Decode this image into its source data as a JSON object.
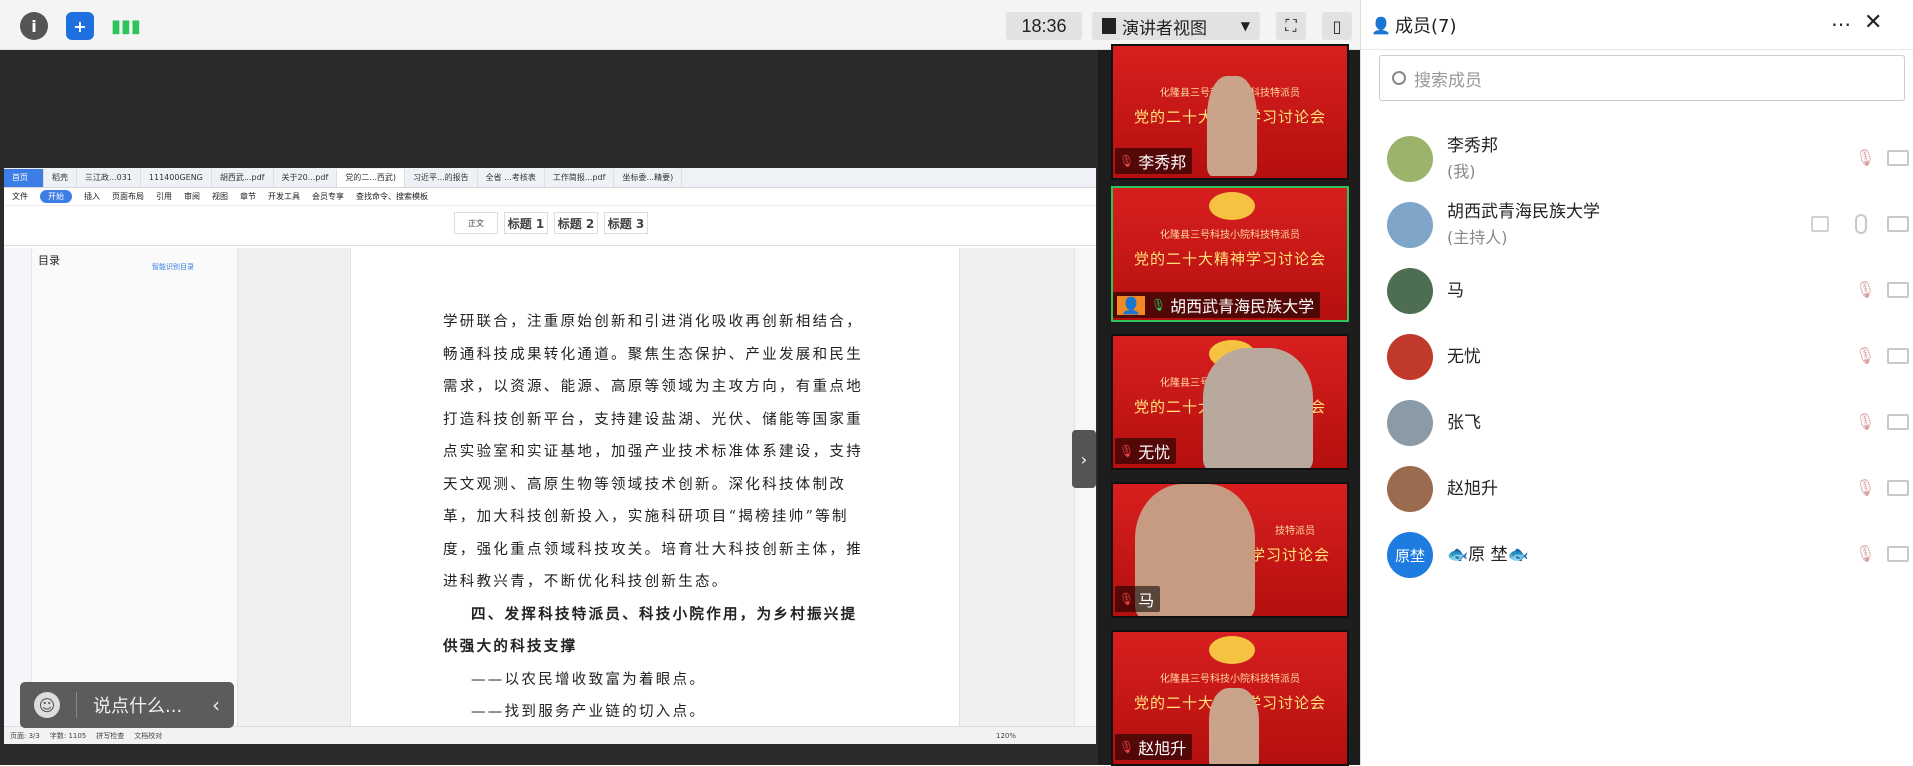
{
  "topbar": {
    "time": "18:36",
    "view_label": "演讲者视图",
    "icons": [
      "info-icon",
      "shield-icon",
      "signal-icon",
      "fullscreen-icon",
      "sidebar-toggle-icon"
    ]
  },
  "wps": {
    "tabs": [
      "首页",
      "稻壳",
      "三江政...031",
      "111400GENG",
      "胡西武...pdf",
      "关于20...pdf",
      "党的二...西武)",
      "习近平...的报告",
      "全省 ...考核表",
      "工作简报...pdf",
      "坐标委...精要)"
    ],
    "menus": [
      "文件",
      "开始",
      "插入",
      "页面布局",
      "引用",
      "审阅",
      "视图",
      "章节",
      "开发工具",
      "会员专享",
      "查找命令、搜索模板"
    ],
    "styles": [
      "正文",
      "标题 1",
      "标题 2",
      "标题 3"
    ],
    "toc_title": "目录",
    "toc_tool": "智能识别目录",
    "paragraphs": [
      "学研联合，注重原始创新和引进消化吸收再创新相结合，畅通科技成果转化通道。聚焦生态保护、产业发展和民生需求，以资源、能源、高原等领域为主攻方向，有重点地打造科技创新平台，支持建设盐湖、光伏、储能等国家重点实验室和实证基地，加强产业技术标准体系建设，支持天文观测、高原生物等领域技术创新。深化科技体制改革，加大科技创新投入，实施科研项目“揭榜挂帅”等制度，强化重点领域科技攻关。培育壮大科技创新主体，推进科教兴青，不断优化科技创新生态。",
      "四、发挥科技特派员、科技小院作用，为乡村振兴提供强大的科技支撑",
      "——以农民增收致富为着眼点。",
      "——找到服务产业链的切入点。"
    ],
    "status": [
      "页面: 3/3",
      "字数: 1105",
      "拼写检查",
      "文档校对",
      "120%"
    ]
  },
  "chat": {
    "placeholder": "说点什么..."
  },
  "videos": [
    {
      "name": "李秀邦",
      "title": "党的二十大精神学习讨论会",
      "sub": "化隆县三号科技小院科技特派员",
      "mic": "off"
    },
    {
      "name": "胡西武青海民族大学",
      "title": "党的二十大精神学习讨论会",
      "sub": "化隆县三号科技小院科技特派员",
      "mic": "on"
    },
    {
      "name": "无忧",
      "title": "党的二十大精神学习讨论会",
      "sub": "化隆县三号科技小院科技特派员",
      "mic": "off"
    },
    {
      "name": "马",
      "title": "学习讨论会",
      "sub": "技特派员",
      "mic": "off"
    },
    {
      "name": "赵旭升",
      "title": "党的二十大精神学习讨论会",
      "sub": "化隆县三号科技小院科技特派员",
      "mic": "off"
    }
  ],
  "panel": {
    "title": "成员(7)",
    "search_placeholder": "搜索成员",
    "members": [
      {
        "name": "李秀邦",
        "role": "(我)",
        "avatar_color": "#9bb36a"
      },
      {
        "name": "胡西武青海民族大学",
        "role": "(主持人)",
        "avatar_color": "#7fa6c9"
      },
      {
        "name": "马",
        "role": "",
        "avatar_color": "#4e6e52"
      },
      {
        "name": "无忧",
        "role": "",
        "avatar_color": "#c0392b"
      },
      {
        "name": "张飞",
        "role": "",
        "avatar_color": "#8a9aa6"
      },
      {
        "name": "赵旭升",
        "role": "",
        "avatar_color": "#9a6b4f"
      },
      {
        "name": "🐟原 埜🐟",
        "role": "",
        "avatar_color": "#1e7be0",
        "avatar_text": "原埜"
      }
    ]
  }
}
